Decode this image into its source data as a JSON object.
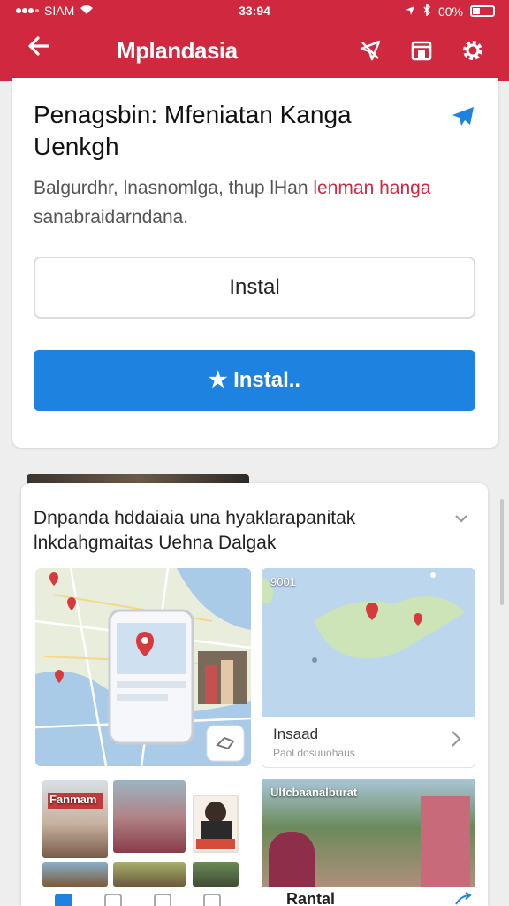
{
  "status_bar": {
    "carrier": "SIAM",
    "time": "33:94",
    "battery": "00%"
  },
  "app_bar": {
    "title": "Mplandasia",
    "icons": [
      "back-arrow-icon",
      "no-location-icon",
      "store-icon",
      "gear-icon"
    ]
  },
  "promo_card": {
    "headline": "Penagsbin: Mfeniatan Kanga Uenkgh",
    "description": "Balgurdhr, lnasnomlga, thup lHan",
    "description_accent": "lenman hanga",
    "description_tail": "sanabraidarndana.",
    "install_outline_label": "Instal",
    "install_primary_label": "★ Instal.."
  },
  "feed_card": {
    "title": "Dnpanda hddaiaia una hyaklarapanitak lnkdahgmaitas Uehna Dalgak",
    "map_tile_2_tag": "9001",
    "info_label": "Insaad",
    "info_sub": "Paol dosuuohaus",
    "video_title": "Ulfcbaanalburat",
    "photo_banner_1": "Fanmam",
    "bottom_label": "Rantal"
  },
  "colors": {
    "brand_red": "#d0283e",
    "primary_blue": "#1e82e0",
    "accent_red_text": "#d0283e"
  }
}
